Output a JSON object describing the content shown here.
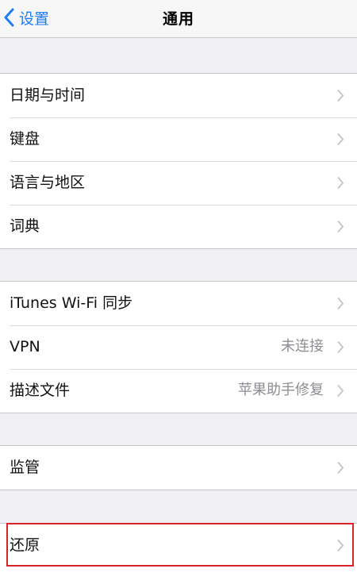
{
  "nav": {
    "back_label": "设置",
    "title": "通用"
  },
  "groups": [
    {
      "rows": [
        {
          "label": "日期与时间",
          "value": ""
        },
        {
          "label": "键盘",
          "value": ""
        },
        {
          "label": "语言与地区",
          "value": ""
        },
        {
          "label": "词典",
          "value": ""
        }
      ]
    },
    {
      "rows": [
        {
          "label": "iTunes Wi-Fi 同步",
          "value": ""
        },
        {
          "label": "VPN",
          "value": "未连接"
        },
        {
          "label": "描述文件",
          "value": "苹果助手修复"
        }
      ]
    },
    {
      "rows": [
        {
          "label": "监管",
          "value": ""
        }
      ]
    },
    {
      "rows": [
        {
          "label": "还原",
          "value": ""
        }
      ]
    }
  ],
  "colors": {
    "accent": "#1f7cf2",
    "highlight": "#d8232a",
    "background": "#efeff4"
  },
  "icons": {
    "back": "chevron-left-icon",
    "row": "chevron-right-icon"
  }
}
